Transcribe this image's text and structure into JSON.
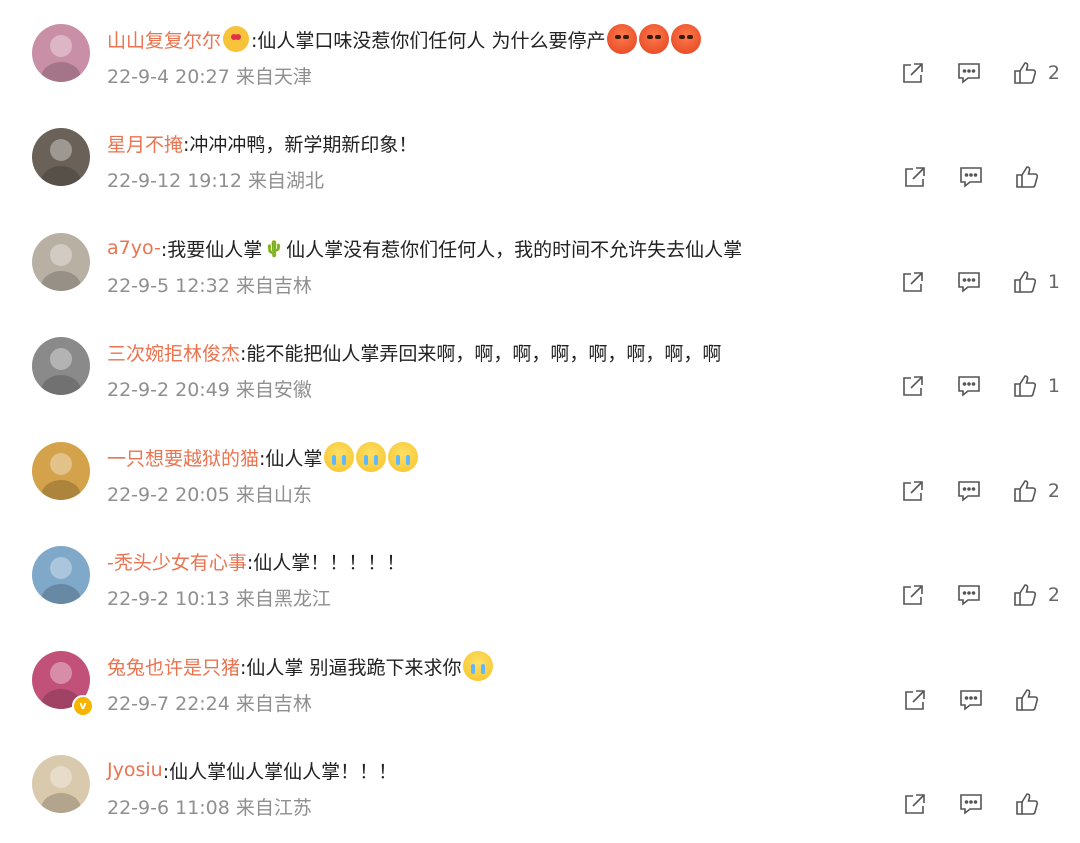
{
  "comments": [
    {
      "username": "山山复复尔尔",
      "prefix_emoji": "love-face",
      "text": ":仙人掌口味没惹你们任何人 为什么要停产",
      "emojis": [
        "angry",
        "angry",
        "angry"
      ],
      "time": "22-9-4 20:27 来自天津",
      "likes": "2",
      "avatar_color": "#c98fa6",
      "verified": false
    },
    {
      "username": "星月不掩",
      "text": ":冲冲冲鸭，新学期新印象！",
      "emojis": [],
      "time": "22-9-12 19:12 来自湖北",
      "likes": "",
      "avatar_color": "#6a6258",
      "verified": false
    },
    {
      "username": "a7yo-",
      "text": ":我要仙人掌",
      "cactus": "🌵",
      "text2": " 仙人掌没有惹你们任何人，我的时间不允许失去仙人掌",
      "emojis": [],
      "time": "22-9-5 12:32 来自吉林",
      "likes": "1",
      "avatar_color": "#b9b0a4",
      "verified": false
    },
    {
      "username": "三次婉拒林俊杰",
      "text": ":能不能把仙人掌弄回来啊，啊，啊，啊，啊，啊，啊，啊",
      "emojis": [],
      "time": "22-9-2 20:49 来自安徽",
      "likes": "1",
      "avatar_color": "#8a8a8a",
      "verified": false
    },
    {
      "username": "一只想要越狱的猫",
      "text": ":仙人掌",
      "emojis": [
        "cry",
        "cry",
        "cry"
      ],
      "time": "22-9-2 20:05 来自山东",
      "likes": "2",
      "avatar_color": "#d3a24a",
      "verified": false
    },
    {
      "username": "-秃头少女有心事",
      "text": ":仙人掌！！！！！",
      "emojis": [],
      "time": "22-9-2 10:13 来自黑龙江",
      "likes": "2",
      "avatar_color": "#7fa8c9",
      "verified": false
    },
    {
      "username": "兔兔也许是只猪",
      "text": ":仙人掌 别逼我跪下来求你",
      "emojis": [
        "cry"
      ],
      "time": "22-9-7 22:24 来自吉林",
      "likes": "",
      "avatar_color": "#c2517a",
      "verified": true
    },
    {
      "username": "Jyosiu",
      "text": ":仙人掌仙人掌仙人掌！！！",
      "emojis": [],
      "time": "22-9-6 11:08 来自江苏",
      "likes": "",
      "avatar_color": "#d9c9ad",
      "verified": false
    }
  ],
  "icons": {
    "share": "share-icon",
    "comment": "comment-icon",
    "like": "thumbs-up-icon"
  },
  "colors": {
    "username": "#eb7350",
    "meta": "#8f8f8f",
    "icon": "#555555"
  }
}
